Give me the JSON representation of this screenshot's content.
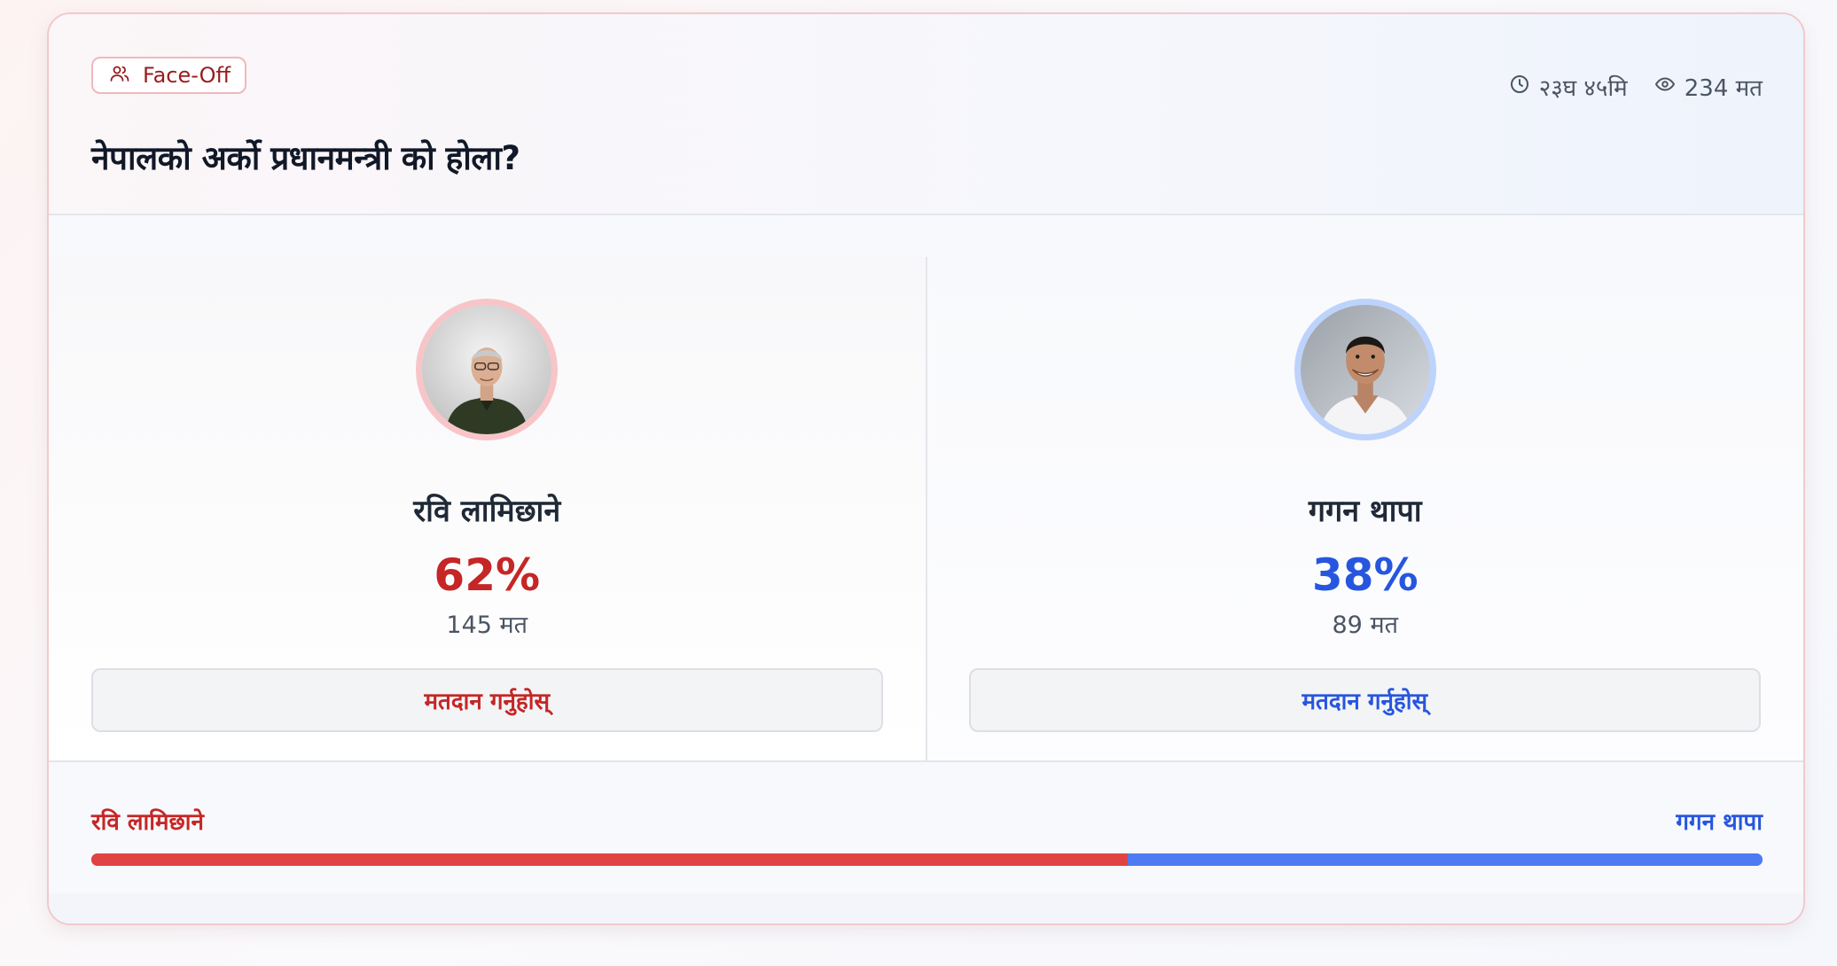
{
  "poll": {
    "badge_label": "Face-Off",
    "time_left": "२३घ ४५मि",
    "total_votes": "234 मत",
    "question": "नेपालको अर्को प्रधानमन्त्री को होला?"
  },
  "candidates": [
    {
      "name": "रवि लामिछाने",
      "percent": "62%",
      "votes": "145 मत",
      "vote_button": "मतदान गर्नुहोस्",
      "color": "#c52626"
    },
    {
      "name": "गगन थापा",
      "percent": "38%",
      "votes": "89 मत",
      "vote_button": "मतदान गर्नुहोस्",
      "color": "#2756de"
    }
  ],
  "progress": {
    "left_label": "रवि लामिछाने",
    "right_label": "गगन थापा",
    "left_share": 0.62,
    "left_color": "#e04343",
    "right_color": "#4e7bf2"
  },
  "icons": {
    "badge": "users-icon",
    "time": "clock-icon",
    "views": "eye-icon"
  }
}
